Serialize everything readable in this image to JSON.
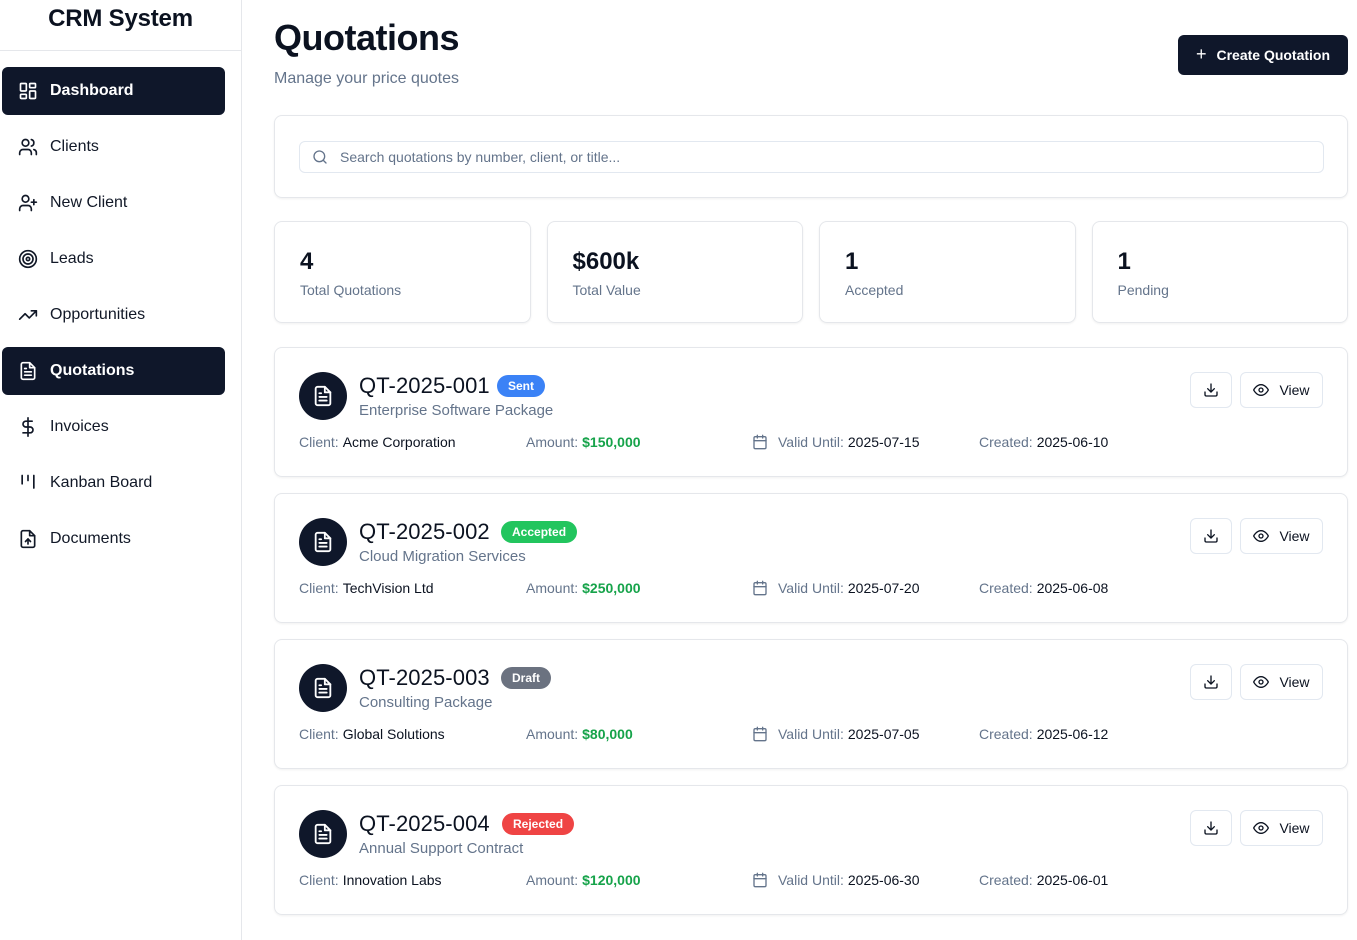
{
  "app": {
    "title": "CRM System"
  },
  "sidebar": {
    "items": [
      {
        "label": "Dashboard",
        "icon": "dashboard-grid-icon"
      },
      {
        "label": "Clients",
        "icon": "users-icon"
      },
      {
        "label": "New Client",
        "icon": "user-plus-icon"
      },
      {
        "label": "Leads",
        "icon": "target-icon"
      },
      {
        "label": "Opportunities",
        "icon": "trending-up-icon"
      },
      {
        "label": "Quotations",
        "icon": "file-text-icon"
      },
      {
        "label": "Invoices",
        "icon": "dollar-icon"
      },
      {
        "label": "Kanban Board",
        "icon": "kanban-icon"
      },
      {
        "label": "Documents",
        "icon": "file-upload-icon"
      }
    ]
  },
  "header": {
    "title": "Quotations",
    "subtitle": "Manage your price quotes",
    "create_label": "Create Quotation"
  },
  "search": {
    "placeholder": "Search quotations by number, client, or title..."
  },
  "stats": [
    {
      "value": "4",
      "label": "Total Quotations"
    },
    {
      "value": "$600k",
      "label": "Total Value"
    },
    {
      "value": "1",
      "label": "Accepted"
    },
    {
      "value": "1",
      "label": "Pending"
    }
  ],
  "labels": {
    "client": "Client:",
    "amount": "Amount:",
    "valid_until": "Valid Until:",
    "created": "Created:",
    "view": "View"
  },
  "status_colors": {
    "Sent": "#3b82f6",
    "Accepted": "#22c55e",
    "Draft": "#6b7280",
    "Rejected": "#ef4444"
  },
  "quotations": [
    {
      "number": "QT-2025-001",
      "status": "Sent",
      "title": "Enterprise Software Package",
      "client": "Acme Corporation",
      "amount": "$150,000",
      "valid_until": "2025-07-15",
      "created": "2025-06-10"
    },
    {
      "number": "QT-2025-002",
      "status": "Accepted",
      "title": "Cloud Migration Services",
      "client": "TechVision Ltd",
      "amount": "$250,000",
      "valid_until": "2025-07-20",
      "created": "2025-06-08"
    },
    {
      "number": "QT-2025-003",
      "status": "Draft",
      "title": "Consulting Package",
      "client": "Global Solutions",
      "amount": "$80,000",
      "valid_until": "2025-07-05",
      "created": "2025-06-12"
    },
    {
      "number": "QT-2025-004",
      "status": "Rejected",
      "title": "Annual Support Contract",
      "client": "Innovation Labs",
      "amount": "$120,000",
      "valid_until": "2025-06-30",
      "created": "2025-06-01"
    }
  ]
}
